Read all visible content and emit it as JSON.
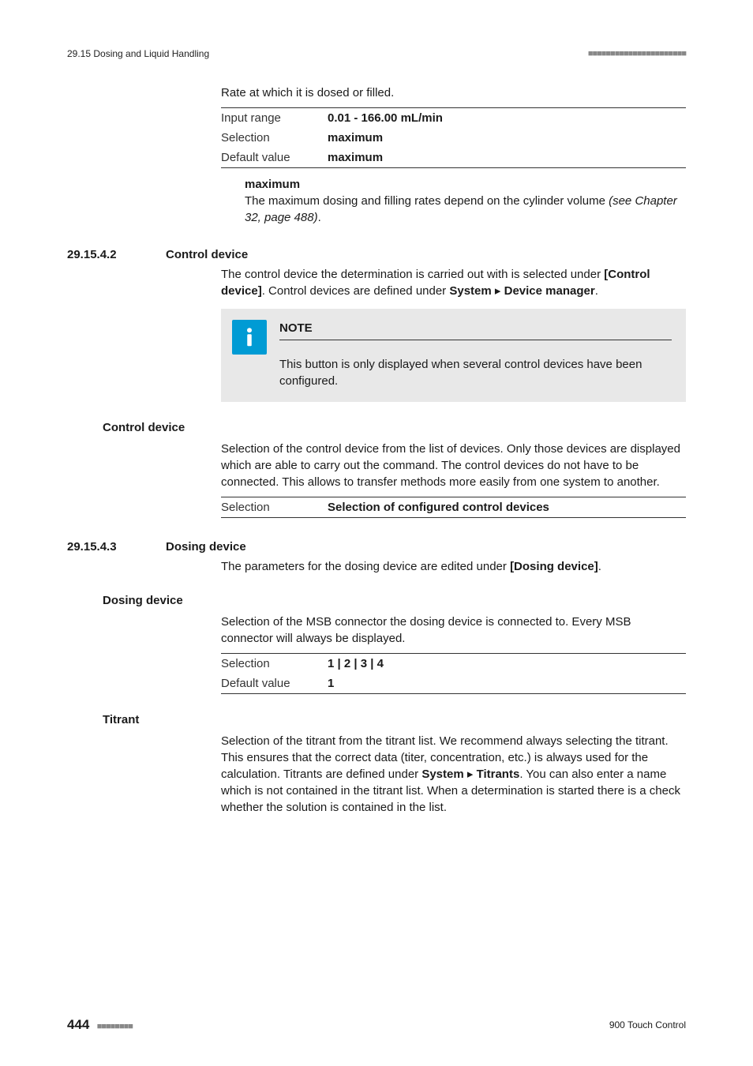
{
  "header": {
    "left": "29.15 Dosing and Liquid Handling",
    "dashes": "■■■■■■■■■■■■■■■■■■■■■■"
  },
  "intro_para": "Rate at which it is dosed or filled.",
  "rate_table": {
    "r1_label": "Input range",
    "r1_value": "0.01 - 166.00 mL/min",
    "r2_label": "Selection",
    "r2_value": "maximum",
    "r3_label": "Default value",
    "r3_value": "maximum"
  },
  "max_heading": "maximum",
  "max_body": "The maximum dosing and filling rates depend on the cylinder volume ",
  "max_ref": "(see Chapter 32, page 488)",
  "max_period": ".",
  "sec_cd": {
    "num": "29.15.4.2",
    "title": "Control device",
    "para_a": "The control device the determination is carried out with is selected under ",
    "btn": "[Control device]",
    "para_b": ". Control devices are defined under ",
    "path1": "System",
    "path2": "Device manager",
    "para_c": "."
  },
  "note": {
    "title": "NOTE",
    "body": "This button is only displayed when several control devices have been configured."
  },
  "cd_field": {
    "label": "Control device",
    "para": "Selection of the control device from the list of devices. Only those devices are displayed which are able to carry out the command. The control devices do not have to be connected. This allows to transfer methods more easily from one system to another.",
    "row_label": "Selection",
    "row_value": "Selection of configured control devices"
  },
  "sec_dd": {
    "num": "29.15.4.3",
    "title": "Dosing device",
    "para_a": "The parameters for the dosing device are edited under ",
    "btn": "[Dosing device]",
    "para_b": "."
  },
  "dd_field": {
    "label": "Dosing device",
    "para": "Selection of the MSB connector the dosing device is connected to. Every MSB connector will always be displayed.",
    "r1_label": "Selection",
    "r1_value": "1 | 2 | 3 | 4",
    "r2_label": "Default value",
    "r2_value": "1"
  },
  "titrant": {
    "label": "Titrant",
    "para_a": "Selection of the titrant from the titrant list. We recommend always selecting the titrant. This ensures that the correct data (titer, concentration, etc.) is always used for the calculation. Titrants are defined under ",
    "path1": "System",
    "path2": "Titrants",
    "para_b": ". You can also enter a name which is not contained in the titrant list. When a determination is started there is a check whether the solution is contained in the list."
  },
  "footer": {
    "page": "444",
    "dashes": "■■■■■■■■",
    "product": "900 Touch Control"
  }
}
